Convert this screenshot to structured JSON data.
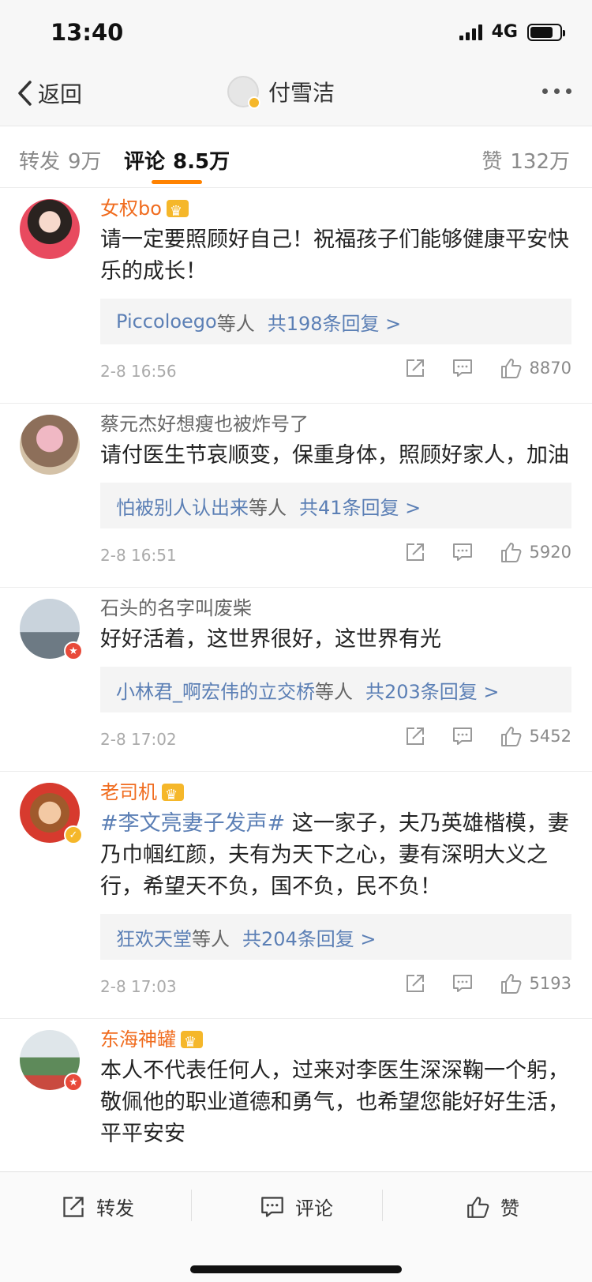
{
  "status_bar": {
    "time": "13:40",
    "network": "4G"
  },
  "nav": {
    "back_label": "返回",
    "title": "付雪洁"
  },
  "tabs": {
    "repost": {
      "label": "转发",
      "count": "9万"
    },
    "comment": {
      "label": "评论",
      "count": "8.5万"
    },
    "like": {
      "label": "赞",
      "count": "132万"
    }
  },
  "comments": [
    {
      "user": "女权bo",
      "vip": true,
      "text": "请一定要照顾好自己！祝福孩子们能够健康平安快乐的成长！",
      "reply_who": "Piccoloego",
      "reply_suffix": "等人",
      "reply_count": "共198条回复 >",
      "time": "2-8 16:56",
      "likes": "8870"
    },
    {
      "user": "蔡元杰好想瘦也被炸号了",
      "vip": false,
      "text": "请付医生节哀顺变，保重身体，照顾好家人，加油",
      "reply_who": "怕被别人认出来",
      "reply_suffix": "等人",
      "reply_count": "共41条回复 >",
      "time": "2-8 16:51",
      "likes": "5920"
    },
    {
      "user": "石头的名字叫废柴",
      "vip": false,
      "text": "好好活着，这世界很好，这世界有光",
      "reply_who": "小林君_啊宏伟的立交桥",
      "reply_suffix": "等人",
      "reply_count": "共203条回复 >",
      "time": "2-8 17:02",
      "likes": "5452"
    },
    {
      "user": "老司机",
      "vip": true,
      "hashtag": "#李文亮妻子发声#",
      "text": " 这一家子，夫乃英雄楷模，妻乃巾帼红颜，夫有为天下之心，妻有深明大义之行，希望天不负，国不负，民不负！",
      "reply_who": "狂欢天堂",
      "reply_suffix": "等人",
      "reply_count": "共204条回复 >",
      "time": "2-8 17:03",
      "likes": "5193"
    },
    {
      "user": "东海神罐",
      "vip": true,
      "text": "本人不代表任何人，过来对李医生深深鞠一个躬，敬佩他的职业道德和勇气，也希望您能好好生活，平平安安"
    }
  ],
  "toolbar": {
    "repost": "转发",
    "comment": "评论",
    "like": "赞"
  },
  "colors": {
    "accent": "#ff8200",
    "link": "#5b7fb5",
    "vip_name": "#f06c1f",
    "verified": "#f5b72a"
  }
}
